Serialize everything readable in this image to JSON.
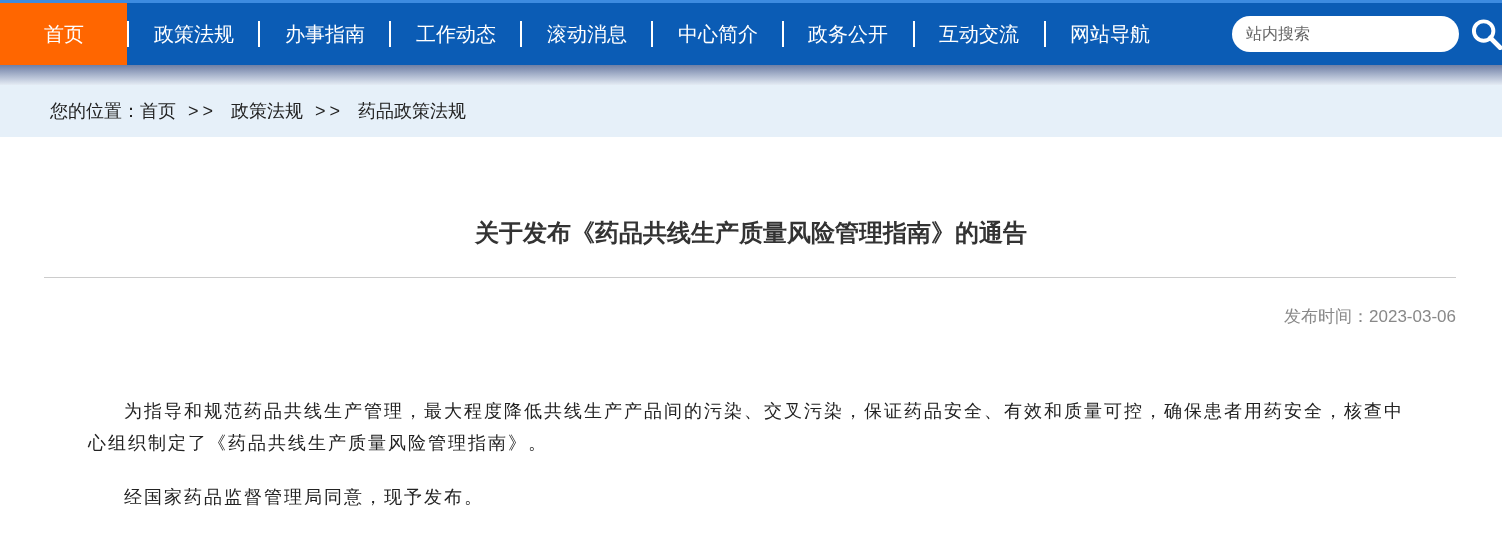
{
  "nav": {
    "items": [
      {
        "label": "首页",
        "selected": true
      },
      {
        "label": "政策法规",
        "selected": false
      },
      {
        "label": "办事指南",
        "selected": false
      },
      {
        "label": "工作动态",
        "selected": false
      },
      {
        "label": "滚动消息",
        "selected": false
      },
      {
        "label": "中心简介",
        "selected": false
      },
      {
        "label": "政务公开",
        "selected": false
      },
      {
        "label": "互动交流",
        "selected": false
      },
      {
        "label": "网站导航",
        "selected": false
      }
    ],
    "search": {
      "placeholder": "站内搜索"
    }
  },
  "breadcrumb": {
    "prefix": "您的位置：",
    "items": [
      {
        "kind": "link",
        "text": "首页"
      },
      {
        "kind": "separator",
        "text": ">>"
      },
      {
        "kind": "link",
        "text": "政策法规"
      },
      {
        "kind": "separator",
        "text": ">>"
      },
      {
        "kind": "link",
        "text": "药品政策法规"
      }
    ]
  },
  "article": {
    "title": "关于发布《药品共线生产质量风险管理指南》的通告",
    "date": "发布时间：2023-03-06",
    "paragraphs": [
      "为指导和规范药品共线生产管理，最大程度降低共线生产产品间的污染、交叉污染，保证药品安全、有效和质量可控，确保患者用药安全，核查中心组织制定了《药品共线生产质量风险管理指南》。",
      "经国家药品监督管理局同意，现予发布。"
    ]
  }
}
